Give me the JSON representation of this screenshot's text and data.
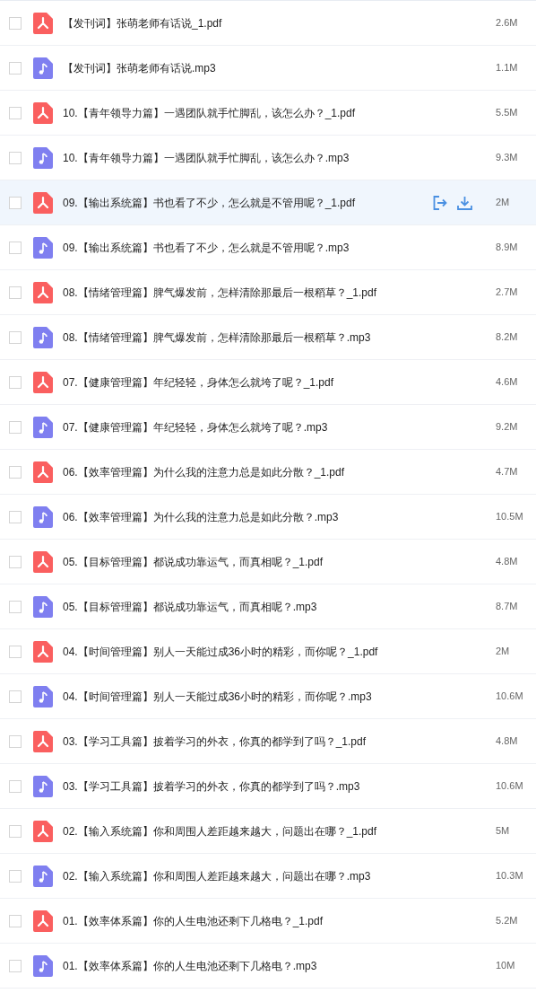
{
  "files": [
    {
      "kind": "pdf",
      "name": "【发刊词】张萌老师有话说_1.pdf",
      "size": "2.6M",
      "checked": false,
      "highlighted": false
    },
    {
      "kind": "audio",
      "name": "【发刊词】张萌老师有话说.mp3",
      "size": "1.1M",
      "checked": false,
      "highlighted": false
    },
    {
      "kind": "pdf",
      "name": "10.【青年领导力篇】一遇团队就手忙脚乱，该怎么办？_1.pdf",
      "size": "5.5M",
      "checked": false,
      "highlighted": false
    },
    {
      "kind": "audio",
      "name": "10.【青年领导力篇】一遇团队就手忙脚乱，该怎么办？.mp3",
      "size": "9.3M",
      "checked": false,
      "highlighted": false
    },
    {
      "kind": "pdf",
      "name": "09.【输出系统篇】书也看了不少，怎么就是不管用呢？_1.pdf",
      "size": "2M",
      "checked": false,
      "highlighted": true
    },
    {
      "kind": "audio",
      "name": "09.【输出系统篇】书也看了不少，怎么就是不管用呢？.mp3",
      "size": "8.9M",
      "checked": false,
      "highlighted": false
    },
    {
      "kind": "pdf",
      "name": "08.【情绪管理篇】脾气爆发前，怎样清除那最后一根稻草？_1.pdf",
      "size": "2.7M",
      "checked": false,
      "highlighted": false
    },
    {
      "kind": "audio",
      "name": "08.【情绪管理篇】脾气爆发前，怎样清除那最后一根稻草？.mp3",
      "size": "8.2M",
      "checked": false,
      "highlighted": false
    },
    {
      "kind": "pdf",
      "name": "07.【健康管理篇】年纪轻轻，身体怎么就垮了呢？_1.pdf",
      "size": "4.6M",
      "checked": false,
      "highlighted": false
    },
    {
      "kind": "audio",
      "name": "07.【健康管理篇】年纪轻轻，身体怎么就垮了呢？.mp3",
      "size": "9.2M",
      "checked": false,
      "highlighted": false
    },
    {
      "kind": "pdf",
      "name": "06.【效率管理篇】为什么我的注意力总是如此分散？_1.pdf",
      "size": "4.7M",
      "checked": false,
      "highlighted": false
    },
    {
      "kind": "audio",
      "name": "06.【效率管理篇】为什么我的注意力总是如此分散？.mp3",
      "size": "10.5M",
      "checked": false,
      "highlighted": false
    },
    {
      "kind": "pdf",
      "name": "05.【目标管理篇】都说成功靠运气，而真相呢？_1.pdf",
      "size": "4.8M",
      "checked": false,
      "highlighted": false
    },
    {
      "kind": "audio",
      "name": "05.【目标管理篇】都说成功靠运气，而真相呢？.mp3",
      "size": "8.7M",
      "checked": false,
      "highlighted": false
    },
    {
      "kind": "pdf",
      "name": "04.【时间管理篇】别人一天能过成36小时的精彩，而你呢？_1.pdf",
      "size": "2M",
      "checked": false,
      "highlighted": false
    },
    {
      "kind": "audio",
      "name": "04.【时间管理篇】别人一天能过成36小时的精彩，而你呢？.mp3",
      "size": "10.6M",
      "checked": false,
      "highlighted": false
    },
    {
      "kind": "pdf",
      "name": "03.【学习工具篇】披着学习的外衣，你真的都学到了吗？_1.pdf",
      "size": "4.8M",
      "checked": false,
      "highlighted": false
    },
    {
      "kind": "audio",
      "name": "03.【学习工具篇】披着学习的外衣，你真的都学到了吗？.mp3",
      "size": "10.6M",
      "checked": false,
      "highlighted": false
    },
    {
      "kind": "pdf",
      "name": "02.【输入系统篇】你和周围人差距越来越大，问题出在哪？_1.pdf",
      "size": "5M",
      "checked": false,
      "highlighted": false
    },
    {
      "kind": "audio",
      "name": "02.【输入系统篇】你和周围人差距越来越大，问题出在哪？.mp3",
      "size": "10.3M",
      "checked": false,
      "highlighted": false
    },
    {
      "kind": "pdf",
      "name": "01.【效率体系篇】你的人生电池还剩下几格电？_1.pdf",
      "size": "5.2M",
      "checked": false,
      "highlighted": false
    },
    {
      "kind": "audio",
      "name": "01.【效率体系篇】你的人生电池还剩下几格电？.mp3",
      "size": "10M",
      "checked": false,
      "highlighted": false
    }
  ]
}
